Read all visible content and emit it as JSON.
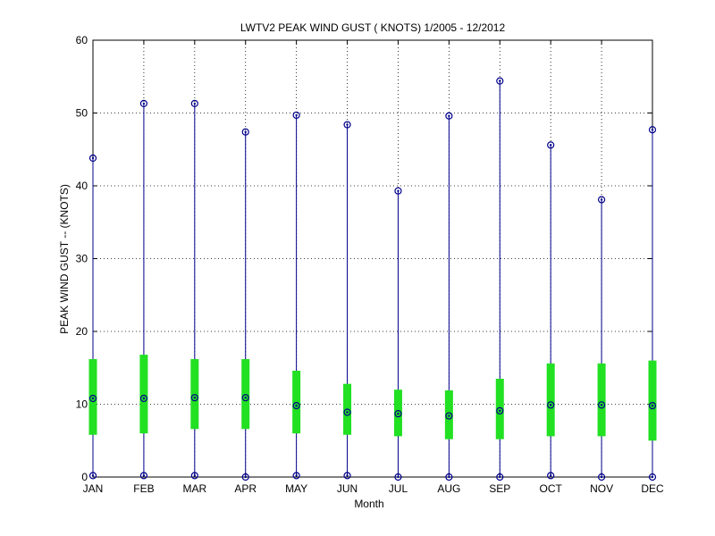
{
  "chart_data": {
    "type": "box",
    "title": "LWTV2  PEAK WIND GUST ( KNOTS) 1/2005 - 12/2012",
    "xlabel": "Month",
    "ylabel": "PEAK WIND GUST -- (KNOTS)",
    "ylim": [
      0,
      60
    ],
    "yticks": [
      "0",
      "10",
      "20",
      "30",
      "40",
      "50",
      "60"
    ],
    "categories": [
      "JAN",
      "FEB",
      "MAR",
      "APR",
      "MAY",
      "JUN",
      "JUL",
      "AUG",
      "SEP",
      "OCT",
      "NOV",
      "DEC"
    ],
    "series": [
      {
        "min": [
          0.2,
          0.2,
          0.2,
          0.0,
          0.2,
          0.2,
          0.0,
          0.0,
          0.0,
          0.2,
          0.0,
          0.0
        ],
        "q1": [
          5.8,
          6.0,
          6.6,
          6.6,
          6.0,
          5.8,
          5.6,
          5.2,
          5.2,
          5.6,
          5.6,
          5.0
        ],
        "median": [
          10.8,
          10.8,
          10.9,
          10.9,
          9.8,
          8.9,
          8.7,
          8.4,
          9.1,
          9.9,
          9.9,
          9.8
        ],
        "q3": [
          16.2,
          16.8,
          16.2,
          16.2,
          14.6,
          12.8,
          12.0,
          11.9,
          13.5,
          15.6,
          15.6,
          16.0
        ],
        "max": [
          43.8,
          51.3,
          51.3,
          47.4,
          49.7,
          48.4,
          39.3,
          49.6,
          54.4,
          45.6,
          38.1,
          47.7
        ]
      }
    ],
    "grid": true,
    "colors": {
      "whisker": "#00008b",
      "box": "#22e022",
      "marker": "#00008b"
    }
  }
}
